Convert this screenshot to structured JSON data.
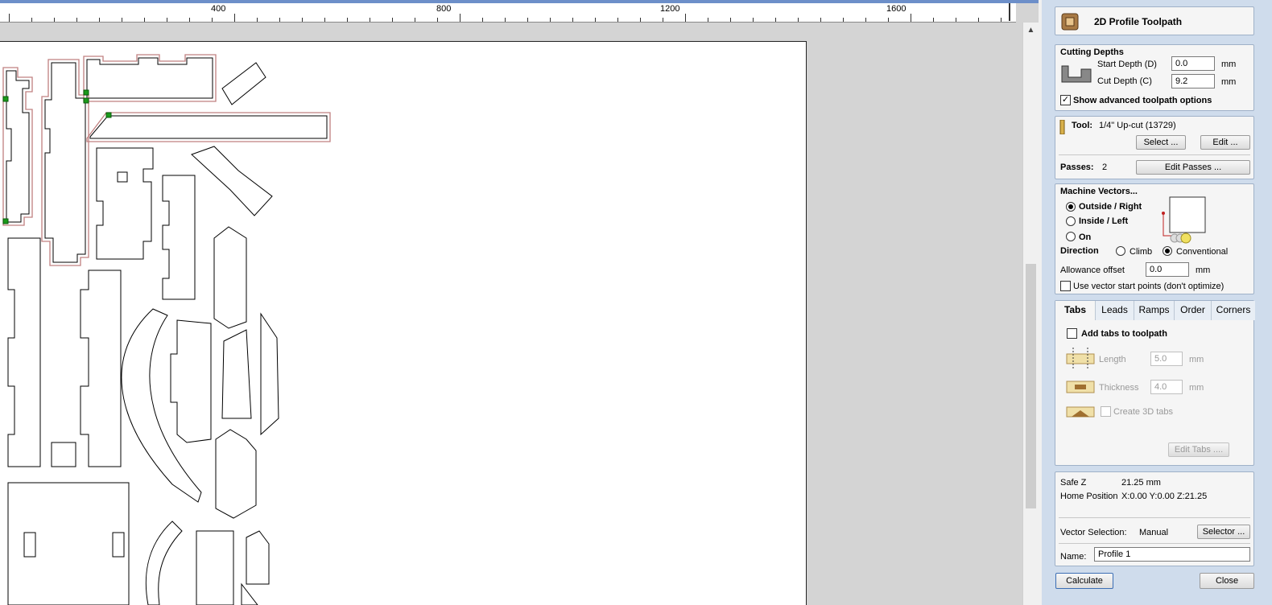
{
  "ruler": {
    "labels": [
      "400",
      "800",
      "1200",
      "1600"
    ]
  },
  "panel": {
    "title": "2D Profile Toolpath",
    "cutting_depths": {
      "heading": "Cutting Depths",
      "start_label": "Start Depth (D)",
      "start_value": "0.0",
      "cut_label": "Cut Depth (C)",
      "cut_value": "9.2",
      "unit": "mm",
      "advanced_label": "Show advanced toolpath options",
      "advanced_checked": true
    },
    "tool": {
      "label": "Tool:",
      "value": "1/4\" Up-cut (13729)",
      "select_button": "Select ...",
      "edit_button": "Edit ...",
      "passes_label": "Passes:",
      "passes_value": "2",
      "edit_passes_button": "Edit Passes ..."
    },
    "machine_vectors": {
      "heading": "Machine Vectors...",
      "options": [
        "Outside / Right",
        "Inside / Left",
        "On"
      ],
      "selected": "Outside / Right",
      "direction_label": "Direction",
      "climb_label": "Climb",
      "conventional_label": "Conventional",
      "direction_selected": "Conventional",
      "allowance_label": "Allowance offset",
      "allowance_value": "0.0",
      "allowance_unit": "mm",
      "start_points_label": "Use vector start points (don't optimize)",
      "start_points_checked": false
    },
    "tabs": {
      "items": [
        "Tabs",
        "Leads",
        "Ramps",
        "Order",
        "Corners"
      ],
      "active": "Tabs",
      "add_tabs_label": "Add tabs to toolpath",
      "add_tabs_checked": false,
      "length_label": "Length",
      "length_value": "5.0",
      "thickness_label": "Thickness",
      "thickness_value": "4.0",
      "unit": "mm",
      "create_3d_label": "Create 3D tabs",
      "edit_tabs_button": "Edit Tabs ...."
    },
    "info": {
      "safe_z_label": "Safe Z",
      "safe_z_value": "21.25 mm",
      "home_label": "Home Position",
      "home_value": "X:0.00 Y:0.00 Z:21.25",
      "vector_selection_label": "Vector Selection:",
      "vector_selection_value": "Manual",
      "selector_button": "Selector ..."
    },
    "name": {
      "label": "Name:",
      "value": "Profile 1"
    },
    "calculate_button": "Calculate",
    "close_button": "Close"
  },
  "colors": {
    "panel_bg": "#cfdcec",
    "toolpath": "#c08080",
    "selection_handle": "#1a9a1a",
    "title_strip": "#6d8fc9"
  }
}
